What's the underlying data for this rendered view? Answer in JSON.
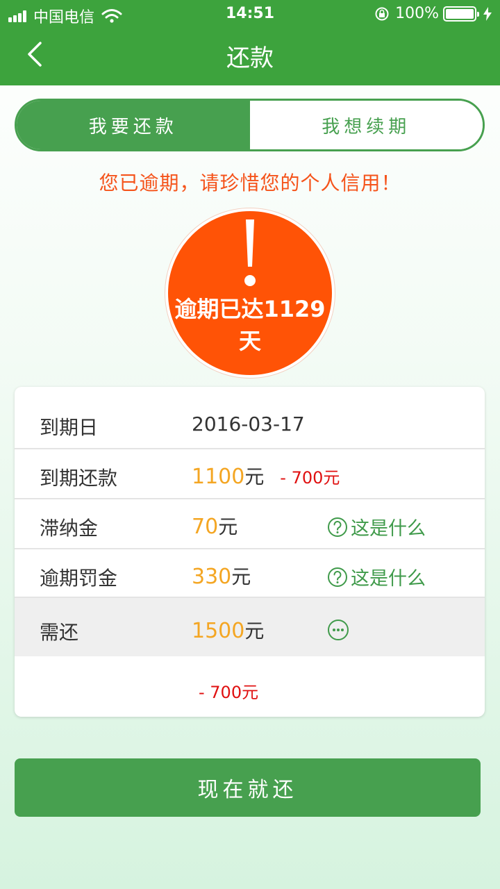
{
  "status_bar": {
    "carrier": "中国电信",
    "time": "14:51",
    "battery": "100%"
  },
  "nav": {
    "title": "还款"
  },
  "segment": {
    "repay_label": "我要还款",
    "renew_label": "我想续期"
  },
  "warning": "您已逾期，请珍惜您的个人信用！",
  "overdue": {
    "line1": "逾期已达1129",
    "line2": "天"
  },
  "details": {
    "due_date": {
      "label": "到期日",
      "value": "2016-03-17"
    },
    "due_amount": {
      "label": "到期还款",
      "amount": "1100",
      "unit": "元",
      "discount": "- 700元"
    },
    "late_fee": {
      "label": "滞纳金",
      "amount": "70",
      "unit": "元",
      "help": "这是什么"
    },
    "penalty": {
      "label": "逾期罚金",
      "amount": "330",
      "unit": "元",
      "help": "这是什么"
    },
    "total": {
      "label": "需还",
      "amount": "1500",
      "unit": "元",
      "discount": "- 700元"
    }
  },
  "pay_button": "现在就还",
  "colors": {
    "primary_green": "#47a04f",
    "header_green": "#3da33d",
    "overdue_orange": "#ff5306",
    "warning_text": "#f5531a",
    "amount_yellow": "#f4a623",
    "discount_red": "#e01010"
  }
}
